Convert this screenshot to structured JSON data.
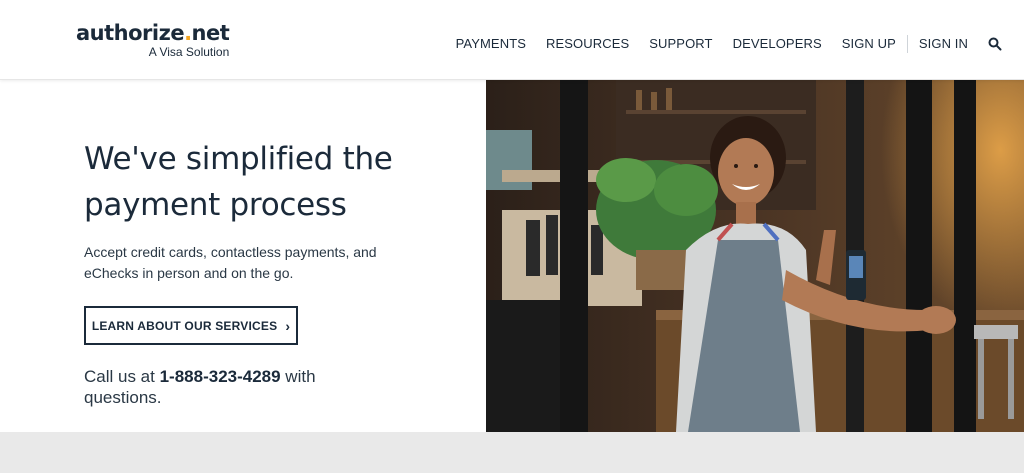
{
  "brand": {
    "name_main": "authorize",
    "name_dot": ".",
    "name_tld": "net",
    "tagline": "A Visa Solution"
  },
  "nav": {
    "items": [
      {
        "label": "PAYMENTS"
      },
      {
        "label": "RESOURCES"
      },
      {
        "label": "SUPPORT"
      },
      {
        "label": "DEVELOPERS"
      },
      {
        "label": "SIGN UP"
      },
      {
        "label": "SIGN IN"
      }
    ],
    "search_icon": "search-icon"
  },
  "hero": {
    "headline": "We've simplified the payment process",
    "subtext": "Accept credit cards, contactless payments, and eChecks in person and on the go.",
    "cta_label": "LEARN ABOUT OUR SERVICES",
    "cta_icon": "chevron-right-icon",
    "call_prefix": "Call us at ",
    "phone": "1-888-323-4289",
    "call_suffix": " with questions."
  },
  "colors": {
    "text_dark": "#1b2a3a",
    "accent_dot": "#f5a623",
    "footer_band": "#e9e9e9"
  }
}
